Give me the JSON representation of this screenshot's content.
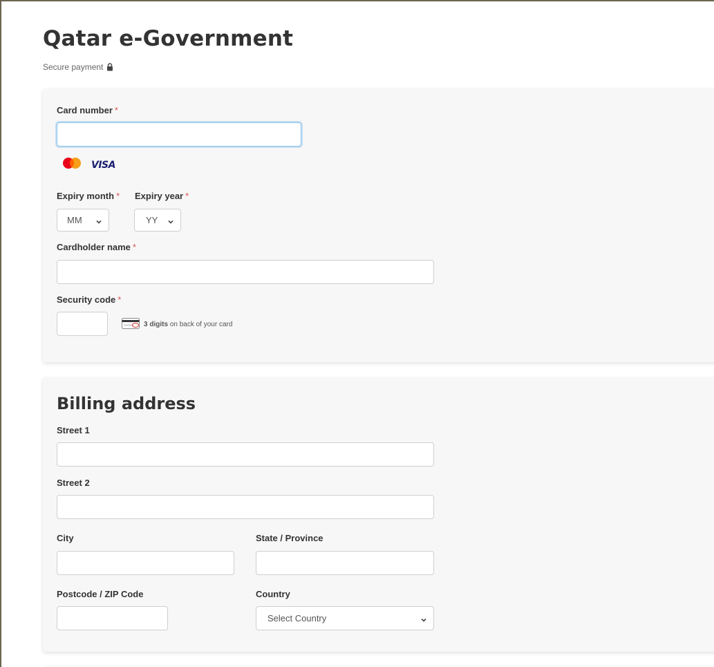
{
  "header": {
    "title": "Qatar e-Government",
    "secure_label": "Secure payment"
  },
  "payment": {
    "card_number": {
      "label": "Card number",
      "required": "*",
      "value": ""
    },
    "brands": [
      "mastercard",
      "VISA"
    ],
    "expiry_month": {
      "label": "Expiry month",
      "required": "*",
      "selected": "MM"
    },
    "expiry_year": {
      "label": "Expiry year",
      "required": "*",
      "selected": "YY"
    },
    "cardholder": {
      "label": "Cardholder name",
      "required": "*",
      "value": ""
    },
    "security_code": {
      "label": "Security code",
      "required": "*",
      "value": "",
      "hint_bold": "3 digits",
      "hint_rest": "on back of your card"
    }
  },
  "billing": {
    "title": "Billing address",
    "street1": {
      "label": "Street 1",
      "value": ""
    },
    "street2": {
      "label": "Street 2",
      "value": ""
    },
    "city": {
      "label": "City",
      "value": ""
    },
    "state": {
      "label": "State / Province",
      "value": ""
    },
    "postcode": {
      "label": "Postcode / ZIP Code",
      "value": ""
    },
    "country": {
      "label": "Country",
      "selected": "Select Country"
    }
  },
  "colors": {
    "required": "#d9534f",
    "focus": "#8cc3e8",
    "visa": "#1a1f71",
    "mastercard_red": "#eb001b",
    "mastercard_orange": "#f79e1b"
  },
  "icons": [
    "lock-icon",
    "mastercard-logo",
    "visa-logo",
    "card-back-icon",
    "chevron-down-icon"
  ]
}
